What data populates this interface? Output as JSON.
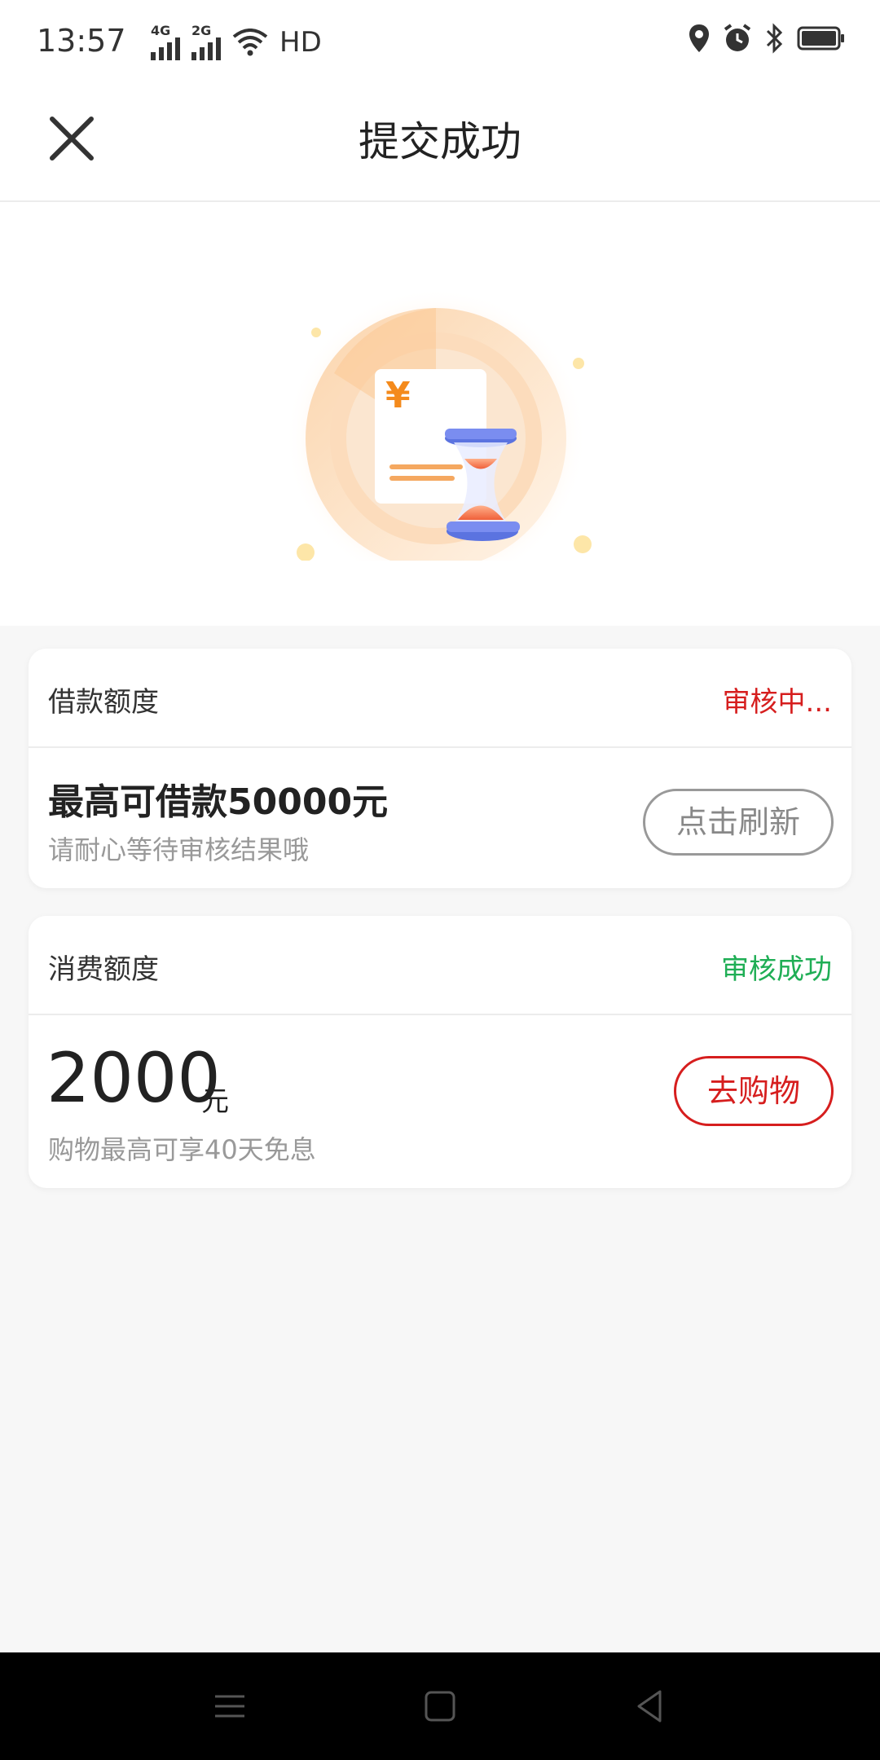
{
  "status_bar": {
    "time": "13:57",
    "signal_1": "4G",
    "signal_2": "2G",
    "hd": "HD"
  },
  "header": {
    "title": "提交成功",
    "close_icon": "close-icon"
  },
  "loan_card": {
    "label": "借款额度",
    "status": "审核中...",
    "amount_text": "最高可借款50000元",
    "subtext": "请耐心等待审核结果哦",
    "button_label": "点击刷新"
  },
  "spend_card": {
    "label": "消费额度",
    "status": "审核成功",
    "amount": "2000",
    "unit": "元",
    "subtext": "购物最高可享40天免息",
    "button_label": "去购物"
  },
  "illustration": {
    "currency_symbol": "¥"
  },
  "colors": {
    "accent_red": "#d61e1e",
    "accent_green": "#1fae55",
    "orange": "#f5a04a"
  }
}
